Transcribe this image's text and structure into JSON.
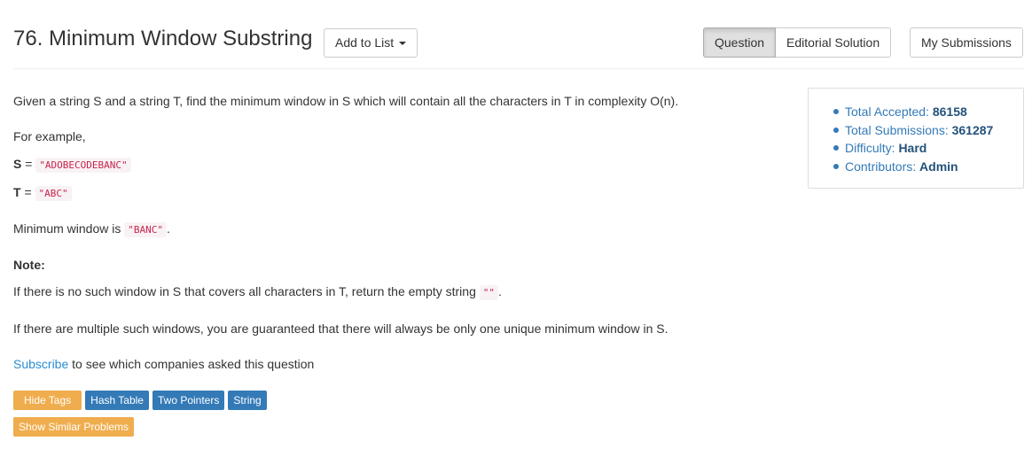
{
  "header": {
    "title": "76. Minimum Window Substring",
    "add_to_list": "Add to List",
    "tabs": [
      "Question",
      "Editorial Solution"
    ],
    "my_submissions": "My Submissions"
  },
  "problem": {
    "intro": "Given a string S and a string T, find the minimum window in S which will contain all the characters in T in complexity O(n).",
    "for_example": "For example,",
    "s_label": "S",
    "s_value": "\"ADOBECODEBANC\"",
    "t_label": "T",
    "t_value": "\"ABC\"",
    "min_window_text": "Minimum window is",
    "min_window_value": "\"BANC\"",
    "note_label": "Note:",
    "note1_text": "If there is no such window in S that covers all characters in T, return the empty string",
    "note1_value": "\"\"",
    "note2_text": "If there are multiple such windows, you are guaranteed that there will always be only one unique minimum window in S.",
    "subscribe_link": "Subscribe",
    "subscribe_text": "to see which companies asked this question"
  },
  "stats": {
    "accepted_label": "Total Accepted:",
    "accepted_value": "86158",
    "submissions_label": "Total Submissions:",
    "submissions_value": "361287",
    "difficulty_label": "Difficulty:",
    "difficulty_value": "Hard",
    "contributors_label": "Contributors:",
    "contributors_value": "Admin"
  },
  "tags": {
    "hide_tags": "Hide Tags",
    "items": [
      "Hash Table",
      "Two Pointers",
      "String"
    ],
    "show_similar": "Show Similar Problems"
  },
  "colors": {
    "tag_blue": "#337ab7",
    "tag_orange": "#f0ad4e",
    "link": "#2a8ed1",
    "code_red": "#c7254e"
  }
}
